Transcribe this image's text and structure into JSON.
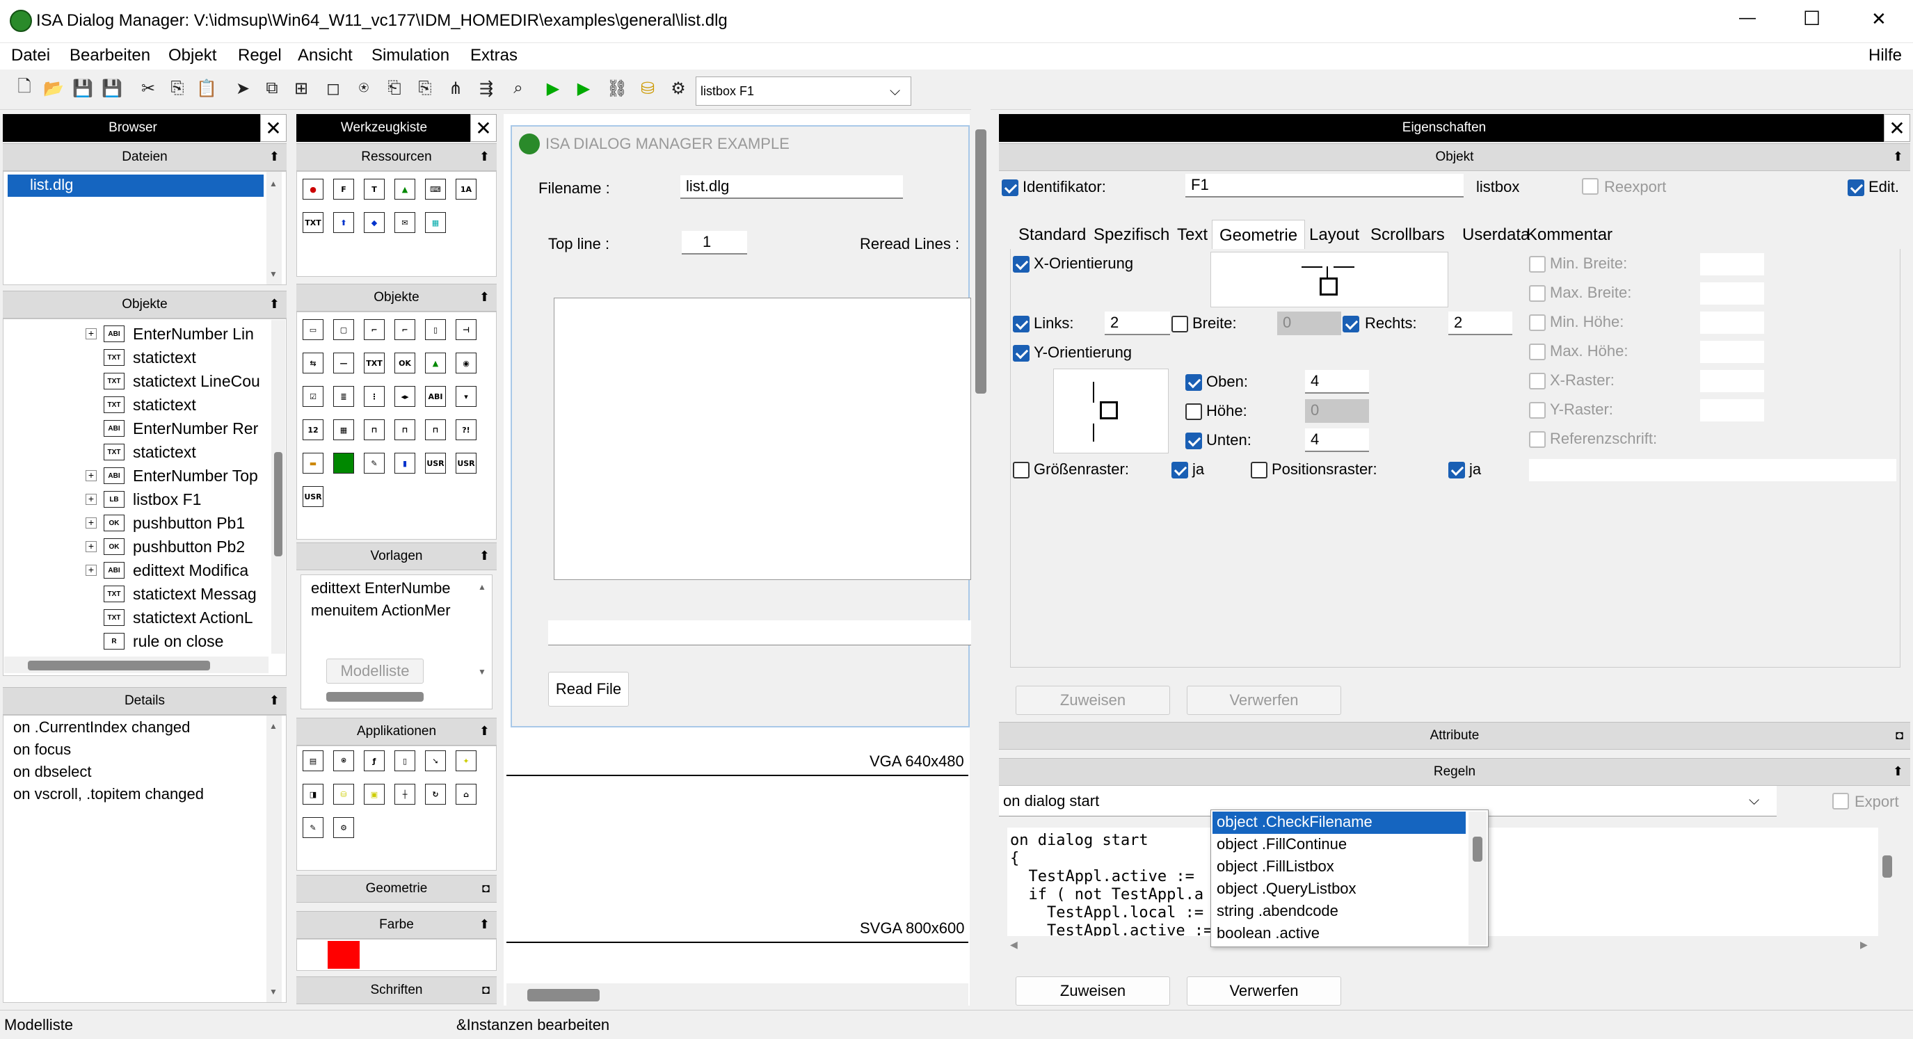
{
  "window": {
    "title": "ISA Dialog Manager: V:\\idmsup\\Win64_W11_vc177\\IDM_HOMEDIR\\examples\\general\\list.dlg",
    "minimize_glyph": "—",
    "maximize_glyph": "☐",
    "close_glyph": "✕"
  },
  "menu": {
    "items": [
      "Datei",
      "Bearbeiten",
      "Objekt",
      "Regel",
      "Ansicht",
      "Simulation",
      "Extras"
    ],
    "help": "Hilfe"
  },
  "toolbar": {
    "combo_value": "listbox F1",
    "combo_arrow": "⌵"
  },
  "browser": {
    "title": "Browser",
    "close": "✕",
    "sections": {
      "dateien": "Dateien",
      "objekte": "Objekte",
      "details": "Details"
    },
    "files": [
      "list.dlg"
    ],
    "objects": [
      {
        "icon": "ABI",
        "label": "EnterNumber Lin",
        "expandable": true
      },
      {
        "icon": "TXT",
        "label": "statictext",
        "expandable": false
      },
      {
        "icon": "TXT",
        "label": "statictext LineCou",
        "expandable": false
      },
      {
        "icon": "TXT",
        "label": "statictext",
        "expandable": false
      },
      {
        "icon": "ABI",
        "label": "EnterNumber Rer",
        "expandable": false
      },
      {
        "icon": "TXT",
        "label": "statictext",
        "expandable": false
      },
      {
        "icon": "ABI",
        "label": "EnterNumber Top",
        "expandable": true
      },
      {
        "icon": "LB",
        "label": "listbox F1",
        "expandable": true
      },
      {
        "icon": "OK",
        "label": "pushbutton Pb1",
        "expandable": true
      },
      {
        "icon": "OK",
        "label": "pushbutton Pb2",
        "expandable": true
      },
      {
        "icon": "ABI",
        "label": "edittext Modifica",
        "expandable": true
      },
      {
        "icon": "TXT",
        "label": "statictext Messag",
        "expandable": false
      },
      {
        "icon": "TXT",
        "label": "statictext ActionL",
        "expandable": false
      },
      {
        "icon": "R",
        "label": "rule on close",
        "expandable": false
      }
    ],
    "details": [
      "on .CurrentIndex changed",
      "on focus",
      "on dbselect",
      "on vscroll, .topitem changed"
    ]
  },
  "toolbox": {
    "title": "Werkzeugkiste",
    "close": "✕",
    "sections": {
      "ressourcen": "Ressourcen",
      "objekte": "Objekte",
      "vorlagen": "Vorlagen",
      "applikationen": "Applikationen",
      "geometrie": "Geometrie",
      "farbe": "Farbe",
      "schriften": "Schriften"
    },
    "templates": [
      "edittext EnterNumbe",
      "menuitem ActionMer"
    ],
    "model_list_button": "Modelliste",
    "color_swatch": "#ff0000"
  },
  "preview": {
    "window_title": "ISA DIALOG MANAGER EXAMPLE",
    "filename_label": "Filename :",
    "filename_value": "list.dlg",
    "topline_label": "Top line :",
    "topline_value": "1",
    "reread_label": "Reread Lines :",
    "read_button": "Read File",
    "vga_label": "VGA 640x480",
    "svga_label": "SVGA 800x600"
  },
  "properties": {
    "title": "Eigenschaften",
    "close": "✕",
    "object_section": "Objekt",
    "identifier_label": "Identifikator:",
    "identifier_value": "F1",
    "type_label": "listbox",
    "reexport_label": "Reexport",
    "edit_label": "Edit.",
    "tabs": [
      "Standard",
      "Spezifisch",
      "Text",
      "Geometrie",
      "Layout",
      "Scrollbars",
      "Userdata",
      "Kommentar"
    ],
    "active_tab": "Geometrie",
    "geometry": {
      "x_orient_label": "X-Orientierung",
      "links_label": "Links:",
      "links_value": "2",
      "breite_label": "Breite:",
      "breite_value": "0",
      "rechts_label": "Rechts:",
      "rechts_value": "2",
      "y_orient_label": "Y-Orientierung",
      "oben_label": "Oben:",
      "oben_value": "4",
      "hoehe_label": "Höhe:",
      "hoehe_value": "0",
      "unten_label": "Unten:",
      "unten_value": "4",
      "groessenraster_label": "Größenraster:",
      "positionsraster_label": "Positionsraster:",
      "ja_label": "ja",
      "min_breite_label": "Min. Breite:",
      "max_breite_label": "Max. Breite:",
      "min_hoehe_label": "Min. Höhe:",
      "max_hoehe_label": "Max. Höhe:",
      "x_raster_label": "X-Raster:",
      "y_raster_label": "Y-Raster:",
      "referenzschrift_label": "Referenzschrift:"
    },
    "assign_button": "Zuweisen",
    "discard_button": "Verwerfen",
    "attribute_section": "Attribute",
    "rules_section": "Regeln",
    "rules_combo_value": "on dialog start",
    "export_label": "Export",
    "code_lines": [
      "on dialog start",
      "{",
      "  TestAppl.active :=",
      "  if ( not TestAppl.a",
      "    TestAppl.local :=",
      "    TestAppl.active :="
    ],
    "autocomplete": [
      "object .CheckFilename",
      "object .FillContinue",
      "object .FillListbox",
      "object .QueryListbox",
      "string .abendcode",
      "boolean .active"
    ],
    "rules_assign_button": "Zuweisen",
    "rules_discard_button": "Verwerfen"
  },
  "statusbar": {
    "left": "Modelliste",
    "middle": "&Instanzen bearbeiten"
  }
}
